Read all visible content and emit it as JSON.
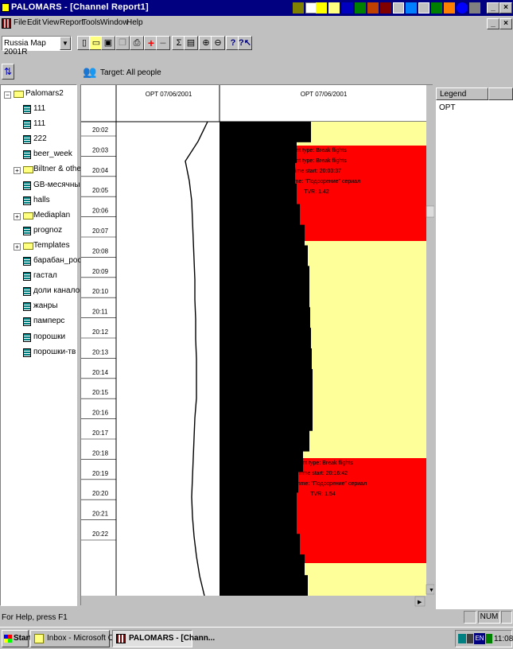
{
  "window": {
    "title": "PALOMARS - [Channel Report1]"
  },
  "menu": [
    "File",
    "Edit",
    "View",
    "Report",
    "Tools",
    "Window",
    "Help"
  ],
  "toolbar": {
    "map_select": "Russia Map 2001R"
  },
  "target": {
    "label": "Target: All people"
  },
  "tree": {
    "root": "Palomars2",
    "items": [
      {
        "label": "111",
        "kind": "report"
      },
      {
        "label": "111",
        "kind": "report"
      },
      {
        "label": "222",
        "kind": "report"
      },
      {
        "label": "beer_week",
        "kind": "report"
      },
      {
        "label": "Biltner & other",
        "kind": "folder"
      },
      {
        "label": "GB-месячный",
        "kind": "report"
      },
      {
        "label": "halls",
        "kind": "report"
      },
      {
        "label": "Mediaplan",
        "kind": "folder"
      },
      {
        "label": "prognoz",
        "kind": "report"
      },
      {
        "label": "Templates",
        "kind": "folder"
      },
      {
        "label": "барабан_россия",
        "kind": "report"
      },
      {
        "label": "гастал",
        "kind": "report"
      },
      {
        "label": "доли каналов",
        "kind": "report"
      },
      {
        "label": "жанры",
        "kind": "report"
      },
      {
        "label": "памперс",
        "kind": "report"
      },
      {
        "label": "порошки",
        "kind": "report"
      },
      {
        "label": "порошки-тв",
        "kind": "report"
      }
    ]
  },
  "chart": {
    "left_header": "OPT 07/06/2001",
    "right_header": "OPT 07/06/2001",
    "times": [
      "20:02",
      "20:03",
      "20:04",
      "20:05",
      "20:06",
      "20:07",
      "20:08",
      "20:09",
      "20:10",
      "20:11",
      "20:12",
      "20:13",
      "20:14",
      "20:15",
      "20:16",
      "20:17",
      "20:18",
      "20:19",
      "20:20",
      "20:21",
      "20:22"
    ],
    "line_points": [
      260,
      248,
      232,
      237,
      240,
      241,
      242,
      243,
      244,
      244,
      245,
      245,
      246,
      246,
      246,
      244,
      243,
      242,
      241,
      240,
      241,
      243,
      246,
      250,
      256
    ],
    "black_steps": [
      390,
      372,
      370,
      372,
      376,
      382,
      386,
      388,
      388,
      389,
      390,
      391,
      392,
      392,
      392,
      388,
      380,
      374,
      372,
      372,
      376,
      382,
      386
    ],
    "colors": {
      "bar": "#000000",
      "fill": "#ffff99",
      "break": "#ff0000"
    },
    "breaks": [
      {
        "lines": [
          "Event type: Break flights",
          "Event type: Break flights",
          "Time start: 20:03:37",
          "Programme: \"Подсорение\" сериал",
          "TVR: 1.42"
        ]
      },
      {
        "lines": [
          "Event type: Break flights",
          "Time start: 20:16:42",
          "Programme: \"Подсорение\" сериал",
          "TVR: 1.54"
        ]
      }
    ]
  },
  "legend": {
    "title": "Legend",
    "items": [
      "OPT"
    ]
  },
  "status": {
    "text": "For Help, press F1",
    "num": "NUM"
  },
  "taskbar": {
    "start": "Start",
    "tasks": [
      "Inbox - Microsoft Outlook",
      "PALOMARS - [Chann..."
    ],
    "tray_lang": "EN",
    "clock": "11:08"
  }
}
